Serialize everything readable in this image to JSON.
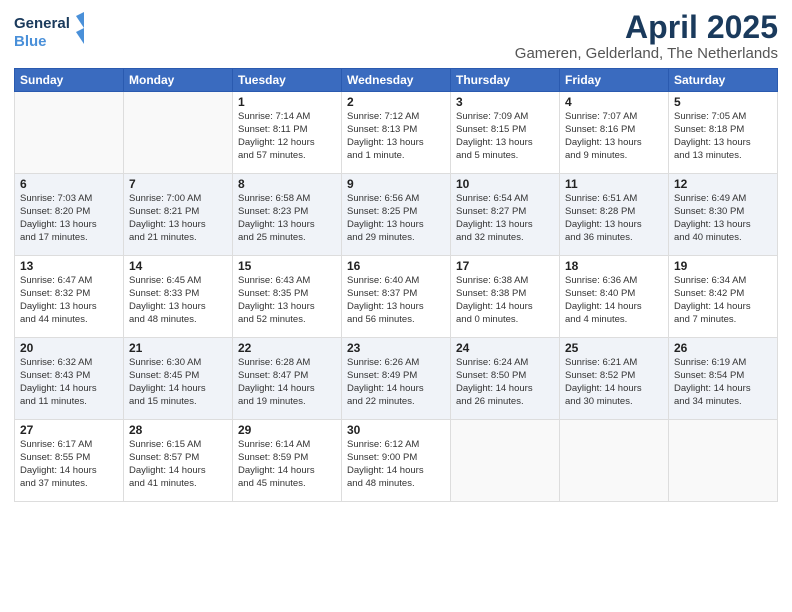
{
  "header": {
    "logo_line1": "General",
    "logo_line2": "Blue",
    "main_title": "April 2025",
    "subtitle": "Gameren, Gelderland, The Netherlands"
  },
  "weekdays": [
    "Sunday",
    "Monday",
    "Tuesday",
    "Wednesday",
    "Thursday",
    "Friday",
    "Saturday"
  ],
  "weeks": [
    [
      {
        "day": "",
        "info": ""
      },
      {
        "day": "",
        "info": ""
      },
      {
        "day": "1",
        "info": "Sunrise: 7:14 AM\nSunset: 8:11 PM\nDaylight: 12 hours\nand 57 minutes."
      },
      {
        "day": "2",
        "info": "Sunrise: 7:12 AM\nSunset: 8:13 PM\nDaylight: 13 hours\nand 1 minute."
      },
      {
        "day": "3",
        "info": "Sunrise: 7:09 AM\nSunset: 8:15 PM\nDaylight: 13 hours\nand 5 minutes."
      },
      {
        "day": "4",
        "info": "Sunrise: 7:07 AM\nSunset: 8:16 PM\nDaylight: 13 hours\nand 9 minutes."
      },
      {
        "day": "5",
        "info": "Sunrise: 7:05 AM\nSunset: 8:18 PM\nDaylight: 13 hours\nand 13 minutes."
      }
    ],
    [
      {
        "day": "6",
        "info": "Sunrise: 7:03 AM\nSunset: 8:20 PM\nDaylight: 13 hours\nand 17 minutes."
      },
      {
        "day": "7",
        "info": "Sunrise: 7:00 AM\nSunset: 8:21 PM\nDaylight: 13 hours\nand 21 minutes."
      },
      {
        "day": "8",
        "info": "Sunrise: 6:58 AM\nSunset: 8:23 PM\nDaylight: 13 hours\nand 25 minutes."
      },
      {
        "day": "9",
        "info": "Sunrise: 6:56 AM\nSunset: 8:25 PM\nDaylight: 13 hours\nand 29 minutes."
      },
      {
        "day": "10",
        "info": "Sunrise: 6:54 AM\nSunset: 8:27 PM\nDaylight: 13 hours\nand 32 minutes."
      },
      {
        "day": "11",
        "info": "Sunrise: 6:51 AM\nSunset: 8:28 PM\nDaylight: 13 hours\nand 36 minutes."
      },
      {
        "day": "12",
        "info": "Sunrise: 6:49 AM\nSunset: 8:30 PM\nDaylight: 13 hours\nand 40 minutes."
      }
    ],
    [
      {
        "day": "13",
        "info": "Sunrise: 6:47 AM\nSunset: 8:32 PM\nDaylight: 13 hours\nand 44 minutes."
      },
      {
        "day": "14",
        "info": "Sunrise: 6:45 AM\nSunset: 8:33 PM\nDaylight: 13 hours\nand 48 minutes."
      },
      {
        "day": "15",
        "info": "Sunrise: 6:43 AM\nSunset: 8:35 PM\nDaylight: 13 hours\nand 52 minutes."
      },
      {
        "day": "16",
        "info": "Sunrise: 6:40 AM\nSunset: 8:37 PM\nDaylight: 13 hours\nand 56 minutes."
      },
      {
        "day": "17",
        "info": "Sunrise: 6:38 AM\nSunset: 8:38 PM\nDaylight: 14 hours\nand 0 minutes."
      },
      {
        "day": "18",
        "info": "Sunrise: 6:36 AM\nSunset: 8:40 PM\nDaylight: 14 hours\nand 4 minutes."
      },
      {
        "day": "19",
        "info": "Sunrise: 6:34 AM\nSunset: 8:42 PM\nDaylight: 14 hours\nand 7 minutes."
      }
    ],
    [
      {
        "day": "20",
        "info": "Sunrise: 6:32 AM\nSunset: 8:43 PM\nDaylight: 14 hours\nand 11 minutes."
      },
      {
        "day": "21",
        "info": "Sunrise: 6:30 AM\nSunset: 8:45 PM\nDaylight: 14 hours\nand 15 minutes."
      },
      {
        "day": "22",
        "info": "Sunrise: 6:28 AM\nSunset: 8:47 PM\nDaylight: 14 hours\nand 19 minutes."
      },
      {
        "day": "23",
        "info": "Sunrise: 6:26 AM\nSunset: 8:49 PM\nDaylight: 14 hours\nand 22 minutes."
      },
      {
        "day": "24",
        "info": "Sunrise: 6:24 AM\nSunset: 8:50 PM\nDaylight: 14 hours\nand 26 minutes."
      },
      {
        "day": "25",
        "info": "Sunrise: 6:21 AM\nSunset: 8:52 PM\nDaylight: 14 hours\nand 30 minutes."
      },
      {
        "day": "26",
        "info": "Sunrise: 6:19 AM\nSunset: 8:54 PM\nDaylight: 14 hours\nand 34 minutes."
      }
    ],
    [
      {
        "day": "27",
        "info": "Sunrise: 6:17 AM\nSunset: 8:55 PM\nDaylight: 14 hours\nand 37 minutes."
      },
      {
        "day": "28",
        "info": "Sunrise: 6:15 AM\nSunset: 8:57 PM\nDaylight: 14 hours\nand 41 minutes."
      },
      {
        "day": "29",
        "info": "Sunrise: 6:14 AM\nSunset: 8:59 PM\nDaylight: 14 hours\nand 45 minutes."
      },
      {
        "day": "30",
        "info": "Sunrise: 6:12 AM\nSunset: 9:00 PM\nDaylight: 14 hours\nand 48 minutes."
      },
      {
        "day": "",
        "info": ""
      },
      {
        "day": "",
        "info": ""
      },
      {
        "day": "",
        "info": ""
      }
    ]
  ]
}
